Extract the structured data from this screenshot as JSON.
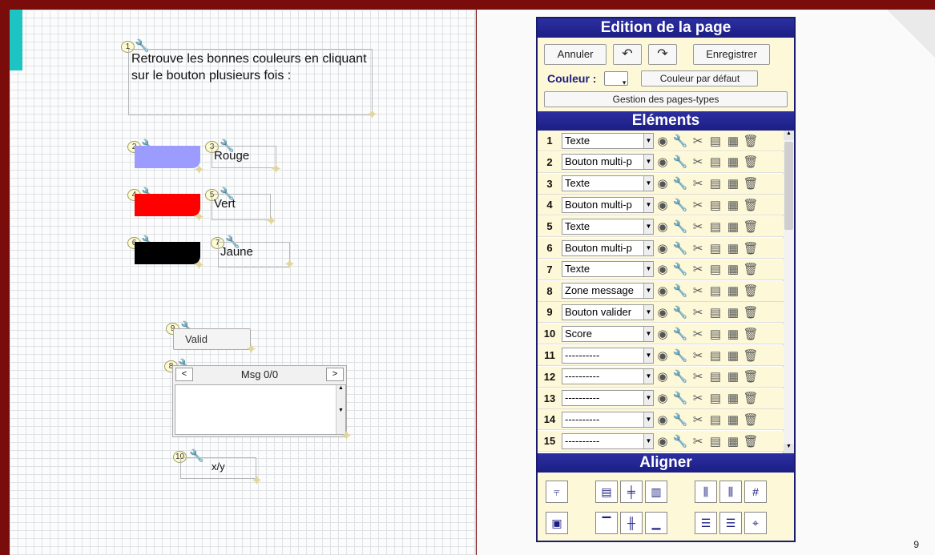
{
  "page": {
    "number": "9"
  },
  "canvas": {
    "items": [
      {
        "badge": "1",
        "text": "Retrouve les bonnes couleurs en cliquant sur le bouton plusieurs fois :"
      },
      {
        "badge": "2",
        "color": "#9c9cff"
      },
      {
        "badge": "3",
        "label": "Rouge"
      },
      {
        "badge": "4",
        "color": "#ff0000"
      },
      {
        "badge": "5",
        "label": "Vert"
      },
      {
        "badge": "6",
        "color": "#000000"
      },
      {
        "badge": "7",
        "label": "Jaune"
      },
      {
        "badge": "8",
        "title": "Msg 0/0",
        "prev": "<",
        "next": ">"
      },
      {
        "badge": "9",
        "label": "Valid"
      },
      {
        "badge": "10",
        "label": "x/y"
      }
    ]
  },
  "panel": {
    "edition_title": "Edition de la page",
    "annuler": "Annuler",
    "undo_icon": "undo-icon",
    "redo_icon": "redo-icon",
    "enregistrer": "Enregistrer",
    "couleur_label": "Couleur :",
    "couleur_defaut": "Couleur par défaut",
    "gestion": "Gestion des pages-types",
    "elements_title": "Eléments",
    "aligner_title": "Aligner",
    "rows": [
      {
        "num": "1",
        "type": "Texte"
      },
      {
        "num": "2",
        "type": "Bouton multi-p"
      },
      {
        "num": "3",
        "type": "Texte"
      },
      {
        "num": "4",
        "type": "Bouton multi-p"
      },
      {
        "num": "5",
        "type": "Texte"
      },
      {
        "num": "6",
        "type": "Bouton multi-p"
      },
      {
        "num": "7",
        "type": "Texte"
      },
      {
        "num": "8",
        "type": "Zone message"
      },
      {
        "num": "9",
        "type": "Bouton valider"
      },
      {
        "num": "10",
        "type": "Score"
      },
      {
        "num": "11",
        "type": "----------"
      },
      {
        "num": "12",
        "type": "----------"
      },
      {
        "num": "13",
        "type": "----------"
      },
      {
        "num": "14",
        "type": "----------"
      },
      {
        "num": "15",
        "type": "----------"
      }
    ]
  },
  "colors": {
    "panel_header": "#1c1e85",
    "panel_bg": "#fdf8d8",
    "border": "#7a0c0c",
    "bookmark": "#1ec4c4"
  }
}
